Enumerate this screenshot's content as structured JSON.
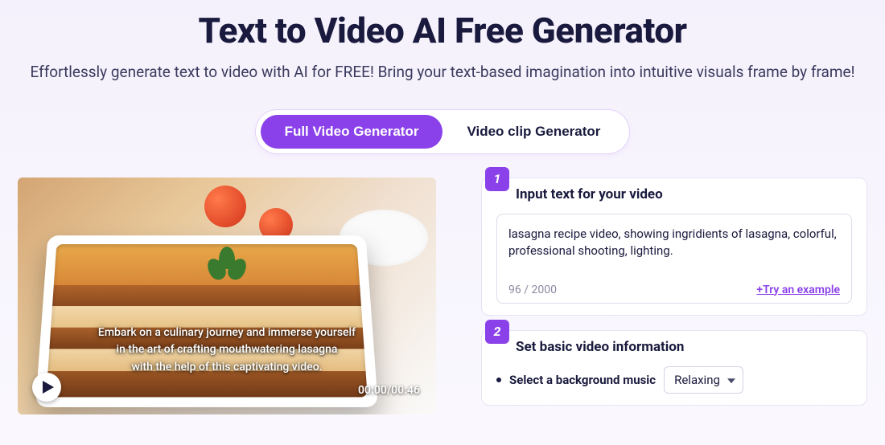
{
  "header": {
    "title": "Text to Video AI Free Generator",
    "subtitle": "Effortlessly generate text to video with AI for FREE! Bring your text-based imagination into intuitive visuals frame by frame!"
  },
  "tabs": {
    "full": "Full Video Generator",
    "clip": "Video clip Generator"
  },
  "preview": {
    "caption_line1": "Embark on a culinary journey and immerse yourself",
    "caption_line2": "in the art of crafting mouthwatering lasagna",
    "caption_line3": "with the help of this captivating video.",
    "timecode": "00:00/00:46"
  },
  "step1": {
    "badge": "1",
    "title": "Input text for your video",
    "text_value": "lasagna recipe video, showing ingridients of lasagna, colorful, professional shooting, lighting.",
    "char_count": "96 / 2000",
    "try_example": "+Try an example"
  },
  "step2": {
    "badge": "2",
    "title": "Set basic video information",
    "music_label": "Select a background music",
    "music_value": "Relaxing"
  }
}
